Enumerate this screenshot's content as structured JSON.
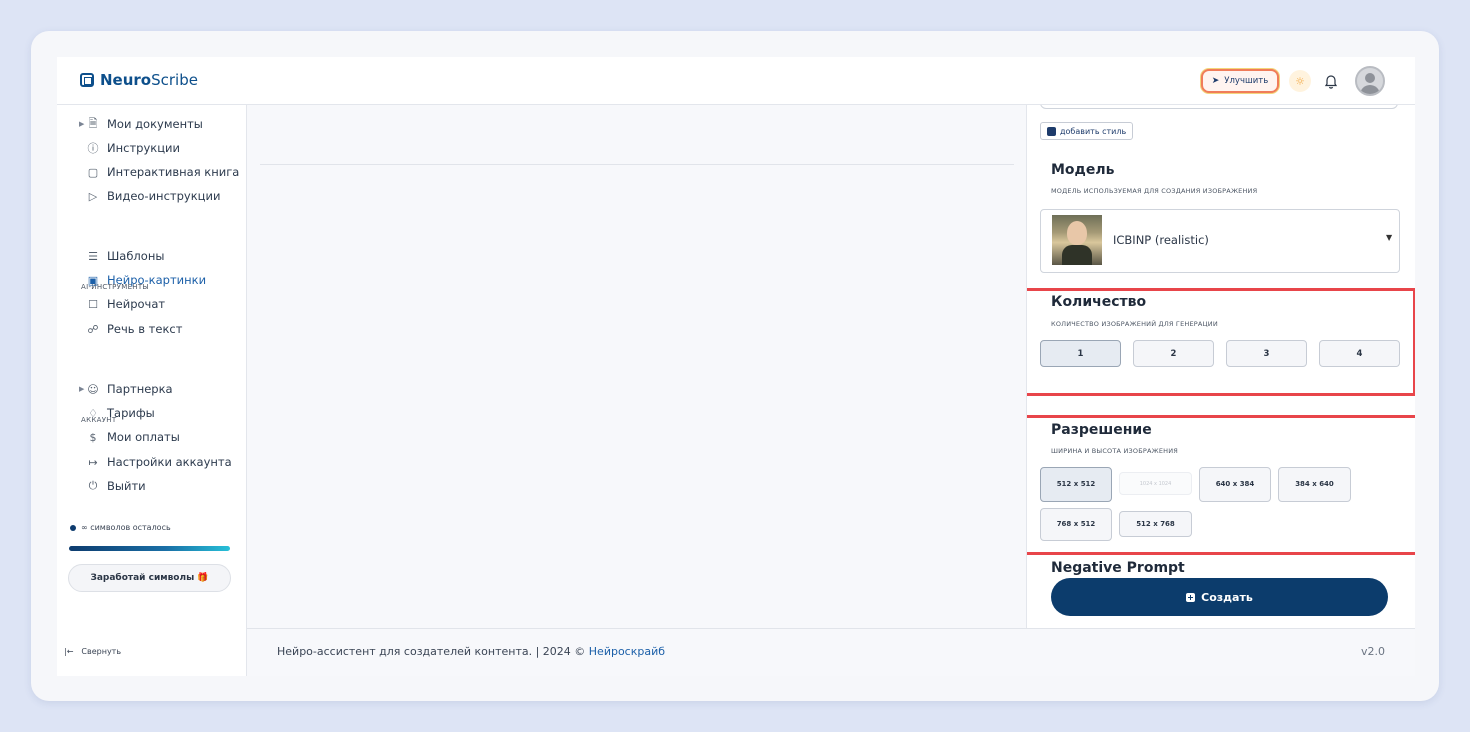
{
  "app": {
    "logo_bold": "Neuro",
    "logo_rest": "Scribe"
  },
  "topbar": {
    "upgrade_label": "Улучшить"
  },
  "sidebar": {
    "items": [
      {
        "label": "Мои документы",
        "icon": "document-icon"
      },
      {
        "label": "Инструкции",
        "icon": "help-circle-icon"
      },
      {
        "label": "Интерактивная книга",
        "icon": "book-icon"
      },
      {
        "label": "Видео-инструкции",
        "icon": "video-icon"
      }
    ],
    "ai_section_label": "AI-ИНСТРУМЕНТЫ",
    "ai_items": [
      {
        "label": "Шаблоны",
        "icon": "layers-icon"
      },
      {
        "label": "Нейро-картинки",
        "icon": "image-icon"
      },
      {
        "label": "Нейрочат",
        "icon": "chat-icon"
      },
      {
        "label": "Речь в текст",
        "icon": "headphones-icon"
      }
    ],
    "account_section_label": "АККАУНТ",
    "account_items": [
      {
        "label": "Партнерка",
        "icon": "users-icon"
      },
      {
        "label": "Тарифы",
        "icon": "tag-icon"
      },
      {
        "label": "Мои оплаты",
        "icon": "dollar-icon"
      },
      {
        "label": "Настройки аккаунта",
        "icon": "settings-icon"
      },
      {
        "label": "Выйти",
        "icon": "power-icon"
      }
    ],
    "symbols_text": "∞ символов осталось",
    "earn_button": "Заработай символы 🎁",
    "collapse_label": "Свернуть"
  },
  "footer": {
    "text": "Нейро-ассистент для создателей контента.  | 2024 © ",
    "link": "Нейроскрайб",
    "version": "v2.0"
  },
  "panel": {
    "add_style_label": "добавить стиль",
    "model": {
      "title": "Модель",
      "subtitle": "МОДЕЛЬ ИСПОЛЬЗУЕМАЯ ДЛЯ СОЗДАНИЯ ИЗОБРАЖЕНИЯ",
      "selected": "ICBINP (realistic)"
    },
    "quantity": {
      "title": "Количество",
      "subtitle": "КОЛИЧЕСТВО ИЗОБРАЖЕНИЙ ДЛЯ ГЕНЕРАЦИИ",
      "options": [
        "1",
        "2",
        "3",
        "4"
      ],
      "selected": "1"
    },
    "resolution": {
      "title": "Разрешение",
      "subtitle": "ШИРИНА И ВЫСОТА ИЗОБРАЖЕНИЯ",
      "options": [
        "512 x 512",
        "1024 x 1024",
        "640 x 384",
        "384 x 640",
        "768 x 512",
        "512 x 768"
      ],
      "selected": "512 x 512",
      "disabled": "1024 x 1024"
    },
    "negative_prompt_title": "Negative Prompt",
    "create_button": "Создать"
  },
  "colors": {
    "accent": "#0c3c6c",
    "highlight": "#e8454a",
    "link": "#1b5fa8"
  }
}
